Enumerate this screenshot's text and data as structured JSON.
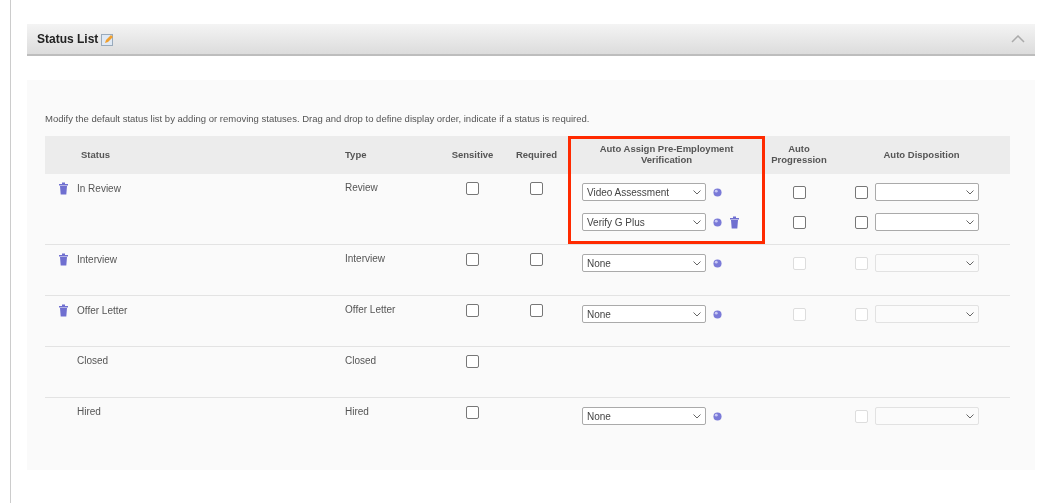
{
  "panel": {
    "title": "Status List",
    "expanded": true
  },
  "instructions": "Modify the default status list by adding or removing statuses. Drag and drop to define display order, indicate if a status is required.",
  "columns": [
    {
      "label": "Status"
    },
    {
      "label": "Type"
    },
    {
      "label": "Sensitive"
    },
    {
      "label": "Required"
    },
    {
      "label": "Auto Assign Pre-Employment Verification",
      "highlighted": true
    },
    {
      "label": "Auto Progression"
    },
    {
      "label": "Auto Disposition"
    }
  ],
  "rows": [
    {
      "status": "In Review",
      "type": "Review",
      "removable": true,
      "highlighted": true,
      "sensitive": {
        "checked": false
      },
      "required": {
        "checked": false
      },
      "assessments": [
        {
          "value": "Video Assessment",
          "removable": false,
          "progression": {
            "checked": false,
            "disabled": false
          },
          "disposition": {
            "checked": false,
            "disabled": false
          }
        },
        {
          "value": "Verify G Plus",
          "removable": true,
          "progression": {
            "checked": false,
            "disabled": false
          },
          "disposition": {
            "checked": false,
            "disabled": false
          }
        }
      ]
    },
    {
      "status": "Interview",
      "type": "Interview",
      "removable": true,
      "sensitive": {
        "checked": false
      },
      "required": {
        "checked": false
      },
      "assessments": [
        {
          "value": "None",
          "removable": false,
          "progression": {
            "checked": false,
            "disabled": true
          },
          "disposition": {
            "checked": false,
            "disabled": true
          }
        }
      ]
    },
    {
      "status": "Offer Letter",
      "type": "Offer Letter",
      "removable": true,
      "sensitive": {
        "checked": false
      },
      "required": {
        "checked": false
      },
      "assessments": [
        {
          "value": "None",
          "removable": false,
          "progression": {
            "checked": false,
            "disabled": true
          },
          "disposition": {
            "checked": false,
            "disabled": true
          }
        }
      ]
    },
    {
      "status": "Closed",
      "type": "Closed",
      "removable": false,
      "sensitive": {
        "checked": false
      }
    },
    {
      "status": "Hired",
      "type": "Hired",
      "removable": false,
      "sensitive": {
        "checked": false
      },
      "assessments": [
        {
          "value": "None",
          "removable": false,
          "disposition": {
            "checked": false,
            "disabled": true
          }
        }
      ]
    }
  ]
}
